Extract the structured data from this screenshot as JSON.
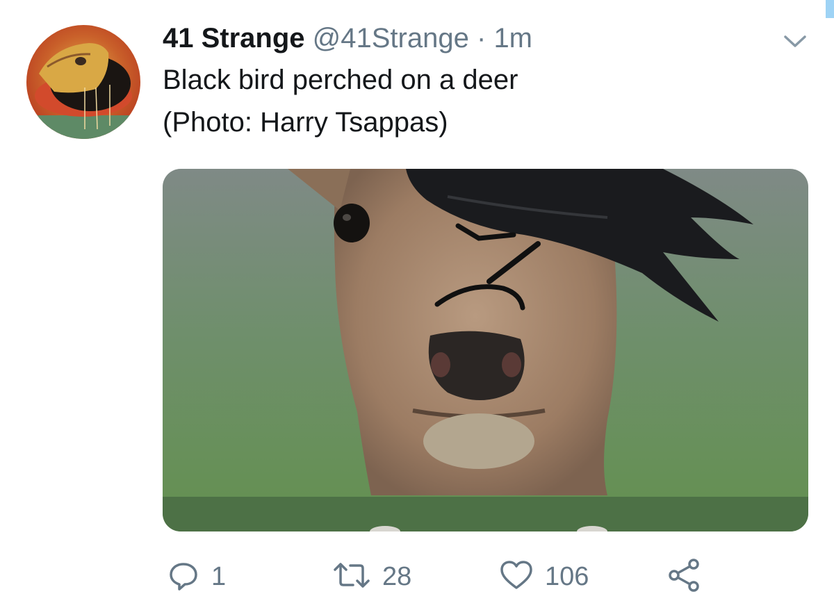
{
  "tweet": {
    "display_name": "41 Strange",
    "handle": "@41Strange",
    "separator": "·",
    "time": "1m",
    "text_line_1": "Black bird perched on a deer",
    "text_line_2": "(Photo: Harry Tsappas)"
  },
  "actions": {
    "reply_count": "1",
    "retweet_count": "28",
    "like_count": "106"
  },
  "icons": {
    "avatar": "avatar-image",
    "caret": "chevron-down-icon",
    "reply": "reply-icon",
    "retweet": "retweet-icon",
    "like": "heart-icon",
    "share": "share-icon"
  },
  "colors": {
    "text_primary": "#14171a",
    "text_secondary": "#657786",
    "accent": "#9ed3f5"
  }
}
